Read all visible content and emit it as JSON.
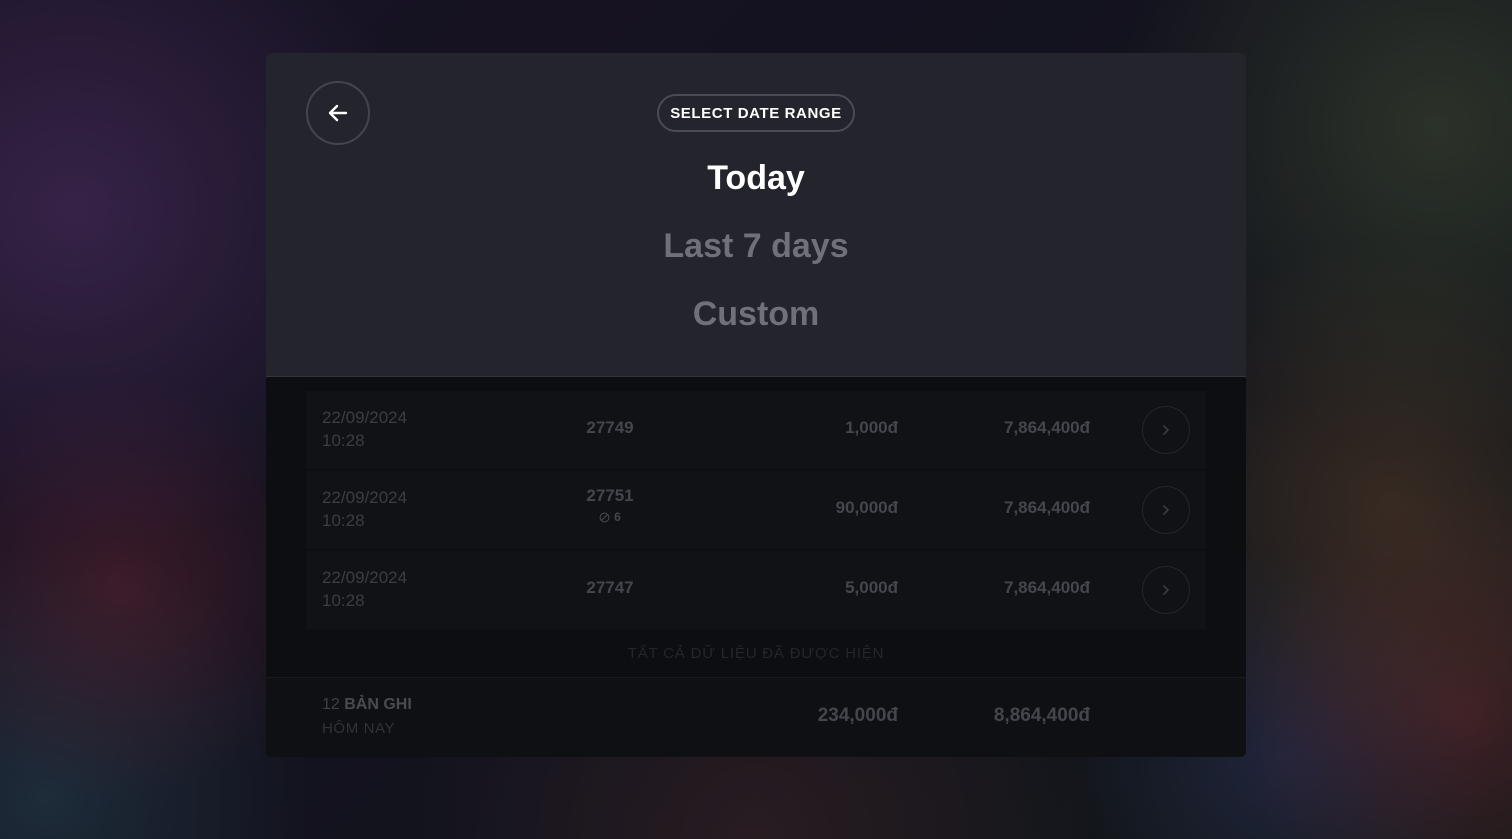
{
  "header": {
    "title": "SELECT DATE RANGE",
    "options": [
      {
        "label": "Today",
        "active": true
      },
      {
        "label": "Last 7 days",
        "active": false
      },
      {
        "label": "Custom",
        "active": false
      }
    ]
  },
  "rows": [
    {
      "date": "22/09/2024",
      "time": "10:28",
      "ticket": "27749",
      "amount": "1,000đ",
      "balance": "7,864,400đ"
    },
    {
      "date": "22/09/2024",
      "time": "10:28",
      "ticket": "27751",
      "badge": "6",
      "amount": "90,000đ",
      "balance": "7,864,400đ"
    },
    {
      "date": "22/09/2024",
      "time": "10:28",
      "ticket": "27747",
      "amount": "5,000đ",
      "balance": "7,864,400đ"
    }
  ],
  "list_end_note": "TẤT CẢ DỮ LIỆU ĐÃ ĐƯỢC HIỆN",
  "footer": {
    "count": "12",
    "count_label": "BẢN GHI",
    "period": "HÔM NAY",
    "total_amount": "234,000đ",
    "total_balance": "8,864,400đ"
  },
  "icons": {
    "back": "arrow-left-icon",
    "row_action": "chevron-right-icon",
    "badge": "slash-circle-icon"
  },
  "colors": {
    "header_bg": "#23242c",
    "panel_bg": "#0d0e12",
    "active_text": "#ffffff",
    "inactive_text": "#6f7078"
  }
}
